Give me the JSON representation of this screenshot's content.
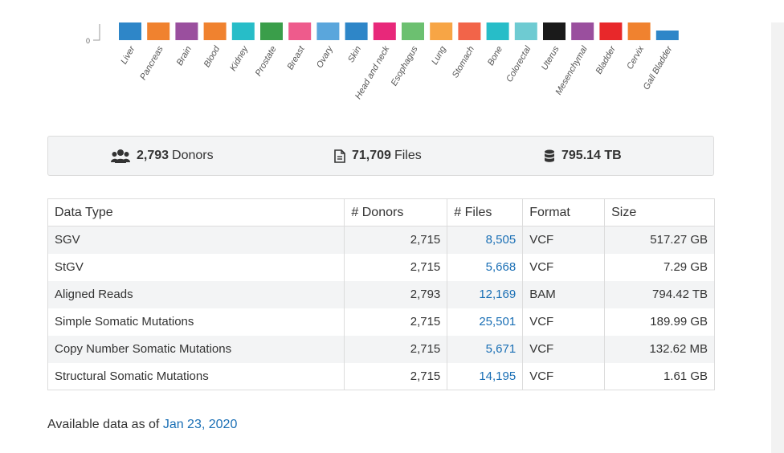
{
  "chart_data": {
    "type": "bar",
    "categories": [
      "Liver",
      "Pancreas",
      "Brain",
      "Blood",
      "Kidney",
      "Prostate",
      "Breast",
      "Ovary",
      "Skin",
      "Head and neck",
      "Esophagus",
      "Lung",
      "Stomach",
      "Bone",
      "Colorectal",
      "Uterus",
      "Mesenchymal",
      "Bladder",
      "Cervix",
      "Gall Bladder"
    ],
    "colors": [
      "#2e86c8",
      "#f0822f",
      "#9a4f9e",
      "#f0822f",
      "#27bdc8",
      "#3a9e4a",
      "#ee5b8c",
      "#5aa6dc",
      "#2e86c8",
      "#e8287a",
      "#6cc070",
      "#f7a545",
      "#f26449",
      "#27bdc8",
      "#6ecbd2",
      "#1a1a1a",
      "#9a4f9e",
      "#e8282a",
      "#f0822f",
      "#2e86c8"
    ],
    "ytick": "0"
  },
  "summary": {
    "donors_value": "2,793",
    "donors_label": "Donors",
    "files_value": "71,709",
    "files_label": "Files",
    "size_value": "795.14 TB",
    "icons": [
      "users-icon",
      "file-icon",
      "database-icon"
    ]
  },
  "table": {
    "headers": [
      "Data Type",
      "# Donors",
      "# Files",
      "Format",
      "Size"
    ],
    "rows": [
      {
        "type": "SGV",
        "donors": "2,715",
        "files": "8,505",
        "format": "VCF",
        "size": "517.27 GB"
      },
      {
        "type": "StGV",
        "donors": "2,715",
        "files": "5,668",
        "format": "VCF",
        "size": "7.29 GB"
      },
      {
        "type": "Aligned Reads",
        "donors": "2,793",
        "files": "12,169",
        "format": "BAM",
        "size": "794.42 TB"
      },
      {
        "type": "Simple Somatic Mutations",
        "donors": "2,715",
        "files": "25,501",
        "format": "VCF",
        "size": "189.99 GB"
      },
      {
        "type": "Copy Number Somatic Mutations",
        "donors": "2,715",
        "files": "5,671",
        "format": "VCF",
        "size": "132.62 MB"
      },
      {
        "type": "Structural Somatic Mutations",
        "donors": "2,715",
        "files": "14,195",
        "format": "VCF",
        "size": "1.61 GB"
      }
    ]
  },
  "footer": {
    "prefix": "Available data as of ",
    "date": "Jan 23, 2020"
  },
  "colors": {
    "link": "#1a6fb5",
    "panel": "#f3f4f5"
  }
}
